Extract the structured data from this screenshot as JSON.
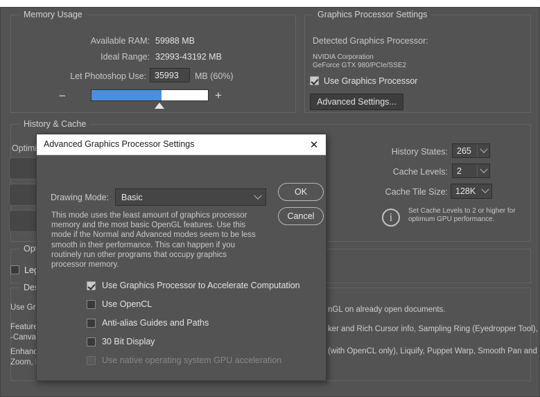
{
  "memory": {
    "group_title": "Memory Usage",
    "available_ram_label": "Available RAM:",
    "available_ram_value": "59988 MB",
    "ideal_range_label": "Ideal Range:",
    "ideal_range_value": "32993-43192 MB",
    "let_use_label": "Let Photoshop Use:",
    "let_use_value": "35993",
    "let_use_suffix": "MB (60%)",
    "minus": "−",
    "plus": "+",
    "fill_percent": 60,
    "accent_color": "#4a8fe0"
  },
  "gpu": {
    "group_title": "Graphics Processor Settings",
    "detected_label": "Detected Graphics Processor:",
    "vendor": "NVIDIA Corporation",
    "model": "GeForce GTX 980/PCIe/SSE2",
    "use_gpu_label": "Use Graphics Processor",
    "use_gpu_checked": true,
    "advanced_button": "Advanced Settings..."
  },
  "history_cache": {
    "group_title": "History & Cache",
    "optimize_label": "Optimi",
    "history_states_label": "History States:",
    "history_states_value": "265",
    "cache_levels_label": "Cache Levels:",
    "cache_levels_value": "2",
    "cache_tile_label": "Cache Tile Size:",
    "cache_tile_value": "128K",
    "info_glyph": "i",
    "info_text_line1": "Set Cache Levels to 2 or higher for",
    "info_text_line2": "optimum GPU performance."
  },
  "options": {
    "group_title": "Optio",
    "legacy_label": "Leg",
    "legacy_checked": false
  },
  "description": {
    "group_title": "Desc",
    "left_lines": [
      "Use Grap",
      "Features",
      "-Canvas",
      "Enhance",
      "Zoom, D"
    ],
    "right_lines": [
      "nGL on already open documents.",
      "ker and Rich Cursor info, Sampling Ring (Eyedropper Tool), On",
      "(with OpenCL only), Liquify, Puppet Warp, Smooth Pan and"
    ]
  },
  "dialog": {
    "title": "Advanced Graphics Processor Settings",
    "close_glyph": "✕",
    "drawing_mode_label": "Drawing Mode:",
    "drawing_mode_value": "Basic",
    "ok_label": "OK",
    "cancel_label": "Cancel",
    "description": "This mode uses the least amount of graphics processor memory and the most basic OpenGL features.  Use this mode if the Normal and Advanced modes seem to be less smooth in their performance.  This can happen if you routinely run other programs that occupy graphics processor memory.",
    "checkboxes": [
      {
        "label": "Use Graphics Processor to Accelerate Computation",
        "checked": true,
        "disabled": false
      },
      {
        "label": "Use OpenCL",
        "checked": false,
        "disabled": false
      },
      {
        "label": "Anti-alias Guides and Paths",
        "checked": false,
        "disabled": false
      },
      {
        "label": "30 Bit Display",
        "checked": false,
        "disabled": false
      },
      {
        "label": "Use native operating system GPU acceleration",
        "checked": false,
        "disabled": true
      }
    ]
  }
}
